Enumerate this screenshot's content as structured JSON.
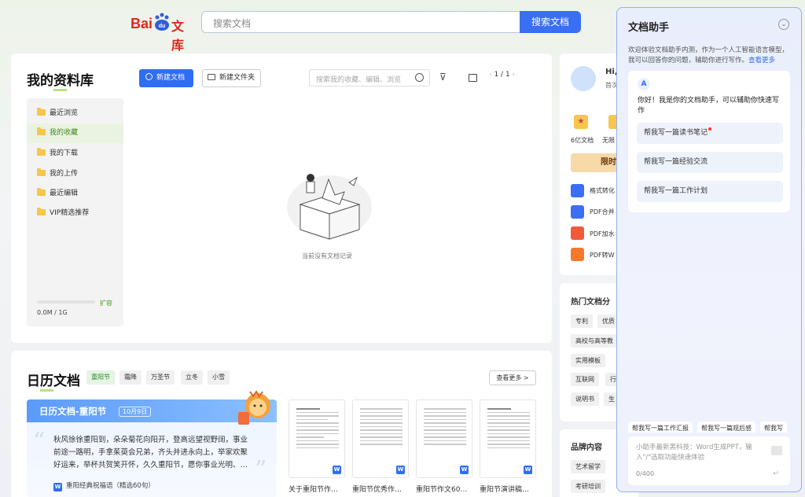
{
  "header": {
    "logo_bai": "Bai",
    "logo_du": "du",
    "logo_wenku": "文库",
    "search_placeholder": "搜索文档",
    "search_button": "搜索文档"
  },
  "library": {
    "title_pre": "我的",
    "title_hl": "资",
    "title_post": "料库",
    "new_doc": "新建文档",
    "new_folder": "新建文件夹",
    "search_placeholder": "搜索我的收藏、编辑、浏览",
    "pager": "1 / 1",
    "sidebar": [
      {
        "label": "最近浏览"
      },
      {
        "label": "我的收藏"
      },
      {
        "label": "我的下载"
      },
      {
        "label": "我的上传"
      },
      {
        "label": "最近编辑"
      },
      {
        "label": "VIP精选推荐"
      }
    ],
    "storage": "0.0M / 1G",
    "expand": "扩容",
    "empty": "当前没有文档记录"
  },
  "calendar": {
    "title_pre": "日",
    "title_hl": "历",
    "title_post": "文档",
    "tags": [
      "重阳节",
      "霜降",
      "万圣节",
      "立冬",
      "小雪"
    ],
    "see_more": "查看更多 >",
    "feature_title": "日历文档-重阳节",
    "feature_date": "10月9日",
    "feature_body": "秋风徐徐重阳到，朵朵菊花向阳开，登高远望视野阔，事业前途一路明，手拿茱萸会兄弟，齐头并进永向上，举家欢聚好运来，举杯共贺笑开怀，久久重阳节，愿你事业光明、…",
    "feature_link": "重阳经典祝福语（精选60句）",
    "docs": [
      {
        "label": "关于重阳节作…"
      },
      {
        "label": "重阳节优秀作…"
      },
      {
        "label": "重阳节作文60…"
      },
      {
        "label": "重阳节演讲稿…"
      }
    ]
  },
  "right": {
    "greeting": "Hi,",
    "sub": "首次",
    "feat1": "6亿文档",
    "feat2": "无限",
    "promo": "限时",
    "tools": [
      "格式转化",
      "PDF合并",
      "PDF加水",
      "PDF转W"
    ],
    "hot_title": "热门文档分",
    "hot_tags": [
      "专利",
      "优质",
      "高校与高等教",
      "实用模板",
      "互联网",
      "行",
      "说明书",
      "生"
    ],
    "brand_title": "品牌内容",
    "brand_tags": [
      "艺术留学",
      "考研培训"
    ]
  },
  "assistant": {
    "title": "文档助手",
    "intro": "欢迎体验文档助手内测，作为一个人工智能语言模型，我可以回答你的问题，辅助你进行写作。",
    "intro_more": "查看更多",
    "greeting": "你好！我是你的文档助手，可以辅助你快速写作",
    "suggestions": [
      "帮我写一篇读书笔记",
      "帮我写一篇经验交流",
      "帮我写一篇工作计划"
    ],
    "chips": [
      "帮我写一篇工作汇报",
      "帮我写一篇观后感",
      "帮我写"
    ],
    "input_placeholder": "小助手最新黑科技：Word生成PPT，输入\"/\"选取功能快速体验",
    "counter": "0/400"
  }
}
